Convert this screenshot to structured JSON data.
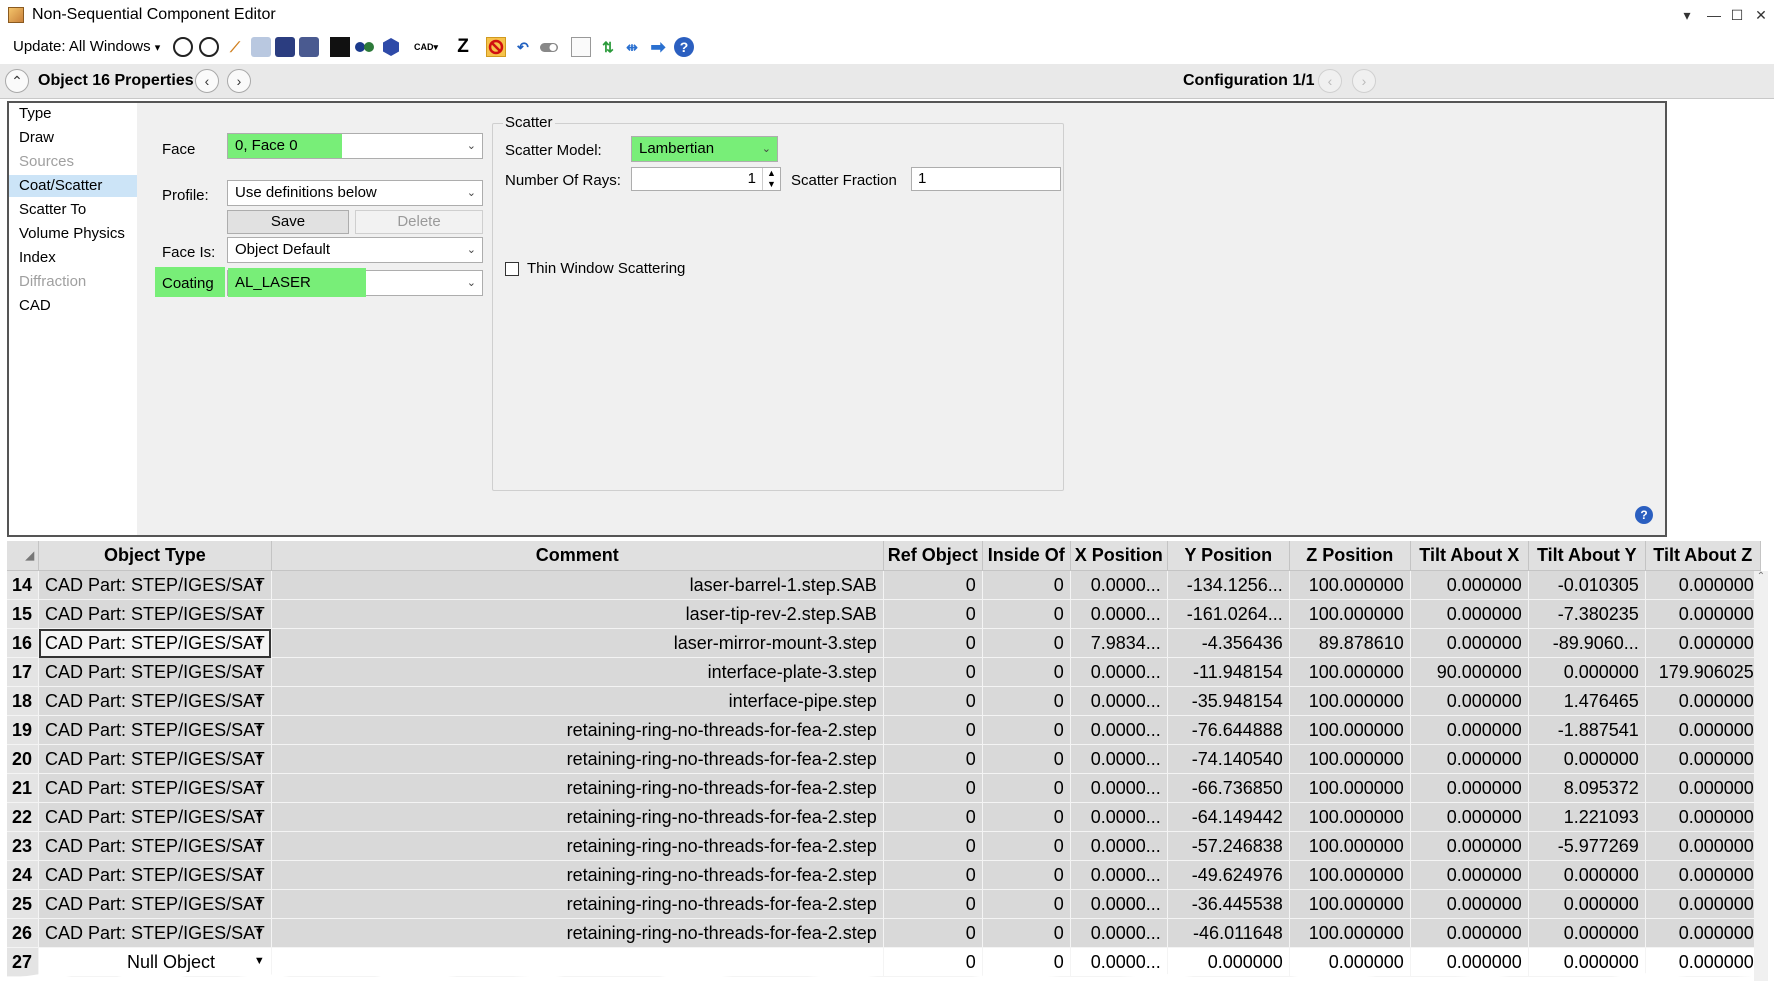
{
  "window": {
    "title": "Non-Sequential Component Editor",
    "buttons": [
      "▾",
      "—",
      "☐",
      "✕"
    ]
  },
  "toolbar": {
    "update_label": "Update: All Windows",
    "update_arrow": "▾",
    "cad_label": "CAD",
    "z_label": "Z",
    "help_glyph": "?"
  },
  "objectbar": {
    "object_label": "Object  16 Properties",
    "config_label": "Configuration 1/1",
    "prev": "‹",
    "next": "›",
    "collapse": "⌃"
  },
  "nav": {
    "items": [
      {
        "label": "Type",
        "state": "normal"
      },
      {
        "label": "Draw",
        "state": "normal"
      },
      {
        "label": "Sources",
        "state": "disabled"
      },
      {
        "label": "Coat/Scatter",
        "state": "selected"
      },
      {
        "label": "Scatter To",
        "state": "normal"
      },
      {
        "label": "Volume Physics",
        "state": "normal"
      },
      {
        "label": "Index",
        "state": "normal"
      },
      {
        "label": "Diffraction",
        "state": "disabled"
      },
      {
        "label": "CAD",
        "state": "normal"
      }
    ]
  },
  "coat": {
    "face_label": "Face",
    "face_value": "0, Face 0",
    "profile_label": "Profile:",
    "profile_value": "Use definitions below",
    "save_label": "Save",
    "delete_label": "Delete",
    "face_is_label": "Face Is:",
    "face_is_value": "Object Default",
    "coating_label": "Coating",
    "coating_value": "AL_LASER"
  },
  "scatter": {
    "group_label": "Scatter",
    "model_label": "Scatter Model:",
    "model_value": "Lambertian",
    "rays_label": "Number Of Rays:",
    "rays_value": "1",
    "fraction_label": "Scatter Fraction",
    "fraction_value": "1",
    "thin_window_label": "Thin Window Scattering"
  },
  "colors": {
    "highlight": "#78ee78",
    "selected_nav": "#cce4f7"
  },
  "table": {
    "columns": [
      "Object Type",
      "Comment",
      "Ref Object",
      "Inside Of",
      "X Position",
      "Y Position",
      "Z Position",
      "Tilt About X",
      "Tilt About Y",
      "Tilt About Z"
    ],
    "rows": [
      [
        "14",
        "CAD Part: STEP/IGES/SAT",
        "laser-barrel-1.step.SAB",
        "0",
        "0",
        "0.0000...",
        "-134.1256...",
        "100.000000",
        "0.000000",
        "-0.010305",
        "0.000000"
      ],
      [
        "15",
        "CAD Part: STEP/IGES/SAT",
        "laser-tip-rev-2.step.SAB",
        "0",
        "0",
        "0.0000...",
        "-161.0264...",
        "100.000000",
        "0.000000",
        "-7.380235",
        "0.000000"
      ],
      [
        "16",
        "CAD Part: STEP/IGES/SAT",
        "laser-mirror-mount-3.step",
        "0",
        "0",
        "7.9834...",
        "-4.356436",
        "89.878610",
        "0.000000",
        "-89.9060...",
        "0.000000"
      ],
      [
        "17",
        "CAD Part: STEP/IGES/SAT",
        "interface-plate-3.step",
        "0",
        "0",
        "0.0000...",
        "-11.948154",
        "100.000000",
        "90.000000",
        "0.000000",
        "179.906025"
      ],
      [
        "18",
        "CAD Part: STEP/IGES/SAT",
        "interface-pipe.step",
        "0",
        "0",
        "0.0000...",
        "-35.948154",
        "100.000000",
        "0.000000",
        "1.476465",
        "0.000000"
      ],
      [
        "19",
        "CAD Part: STEP/IGES/SAT",
        "retaining-ring-no-threads-for-fea-2.step",
        "0",
        "0",
        "0.0000...",
        "-76.644888",
        "100.000000",
        "0.000000",
        "-1.887541",
        "0.000000"
      ],
      [
        "20",
        "CAD Part: STEP/IGES/SAT",
        "retaining-ring-no-threads-for-fea-2.step",
        "0",
        "0",
        "0.0000...",
        "-74.140540",
        "100.000000",
        "0.000000",
        "0.000000",
        "0.000000"
      ],
      [
        "21",
        "CAD Part: STEP/IGES/SAT",
        "retaining-ring-no-threads-for-fea-2.step",
        "0",
        "0",
        "0.0000...",
        "-66.736850",
        "100.000000",
        "0.000000",
        "8.095372",
        "0.000000"
      ],
      [
        "22",
        "CAD Part: STEP/IGES/SAT",
        "retaining-ring-no-threads-for-fea-2.step",
        "0",
        "0",
        "0.0000...",
        "-64.149442",
        "100.000000",
        "0.000000",
        "1.221093",
        "0.000000"
      ],
      [
        "23",
        "CAD Part: STEP/IGES/SAT",
        "retaining-ring-no-threads-for-fea-2.step",
        "0",
        "0",
        "0.0000...",
        "-57.246838",
        "100.000000",
        "0.000000",
        "-5.977269",
        "0.000000"
      ],
      [
        "24",
        "CAD Part: STEP/IGES/SAT",
        "retaining-ring-no-threads-for-fea-2.step",
        "0",
        "0",
        "0.0000...",
        "-49.624976",
        "100.000000",
        "0.000000",
        "0.000000",
        "0.000000"
      ],
      [
        "25",
        "CAD Part: STEP/IGES/SAT",
        "retaining-ring-no-threads-for-fea-2.step",
        "0",
        "0",
        "0.0000...",
        "-36.445538",
        "100.000000",
        "0.000000",
        "0.000000",
        "0.000000"
      ],
      [
        "26",
        "CAD Part: STEP/IGES/SAT",
        "retaining-ring-no-threads-for-fea-2.step",
        "0",
        "0",
        "0.0000...",
        "-46.011648",
        "100.000000",
        "0.000000",
        "0.000000",
        "0.000000"
      ],
      [
        "27",
        "Null Object",
        "",
        "0",
        "0",
        "0.0000...",
        "0.000000",
        "0.000000",
        "0.000000",
        "0.000000",
        "0.000000"
      ]
    ],
    "selected_row": "16"
  }
}
